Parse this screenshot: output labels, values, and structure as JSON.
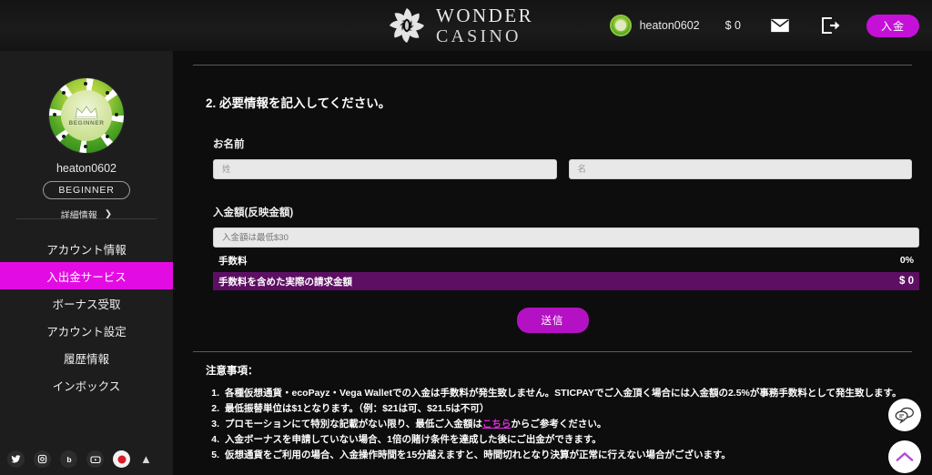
{
  "header": {
    "logo_line1": "WONDER",
    "logo_line2": "CASINO",
    "logo_icon": "spiral-emblem-icon",
    "username": "heaton0602",
    "balance": "$ 0",
    "mail_icon": "envelope-icon",
    "logout_icon": "logout-arrow-icon",
    "deposit_label": "入金"
  },
  "sidebar": {
    "avatar_icon": "poker-chip-avatar-icon",
    "avatar_chip_text": "BEGINNER",
    "username": "heaton0602",
    "rank_badge": "BEGINNER",
    "detail_link": "詳細情報",
    "detail_chevron": "chevron-right-icon",
    "nav": [
      {
        "label": "アカウント情報",
        "active": false
      },
      {
        "label": "入出金サービス",
        "active": true
      },
      {
        "label": "ボーナス受取",
        "active": false
      },
      {
        "label": "アカウント設定",
        "active": false
      },
      {
        "label": "履歴情報",
        "active": false
      },
      {
        "label": "インボックス",
        "active": false
      }
    ],
    "socials": [
      {
        "name": "twitter-icon",
        "glyph": "t"
      },
      {
        "name": "instagram-icon",
        "glyph": "i"
      },
      {
        "name": "blog-icon",
        "glyph": "b"
      },
      {
        "name": "youtube-icon",
        "glyph": "y"
      },
      {
        "name": "japan-flag-icon",
        "glyph": ""
      }
    ],
    "socials_chevron": "chevron-up-icon"
  },
  "main": {
    "step_title": "2. 必要情報を記入してください。",
    "name_label": "お名前",
    "last_name_placeholder": "姓",
    "first_name_placeholder": "名",
    "last_name_value": "",
    "first_name_value": "",
    "amount_label": "入金額(反映金額)",
    "amount_placeholder": "入金額は最低$30",
    "amount_value": "",
    "fee_label": "手数料",
    "fee_value": "0%",
    "total_label": "手数料を含めた実際の請求金額",
    "total_value": "$ 0",
    "submit_label": "送信",
    "notes_title": "注意事項：",
    "notes": [
      {
        "num": "1.",
        "text": "各種仮想通貨・ecoPayz・Vega Walletでの入金は手数料が発生致しません。STICPAYでご入金頂く場合には入金額の2.5%が事務手数料として発生致します。"
      },
      {
        "num": "2.",
        "text": "最低振替単位は$1となります。（例：$21は可、$21.5は不可）"
      },
      {
        "num": "3.",
        "text": "プロモーションにて特別な記載がない限り、最低ご入金額は",
        "link": "こちら",
        "text_after": "からご参考ください。"
      },
      {
        "num": "4.",
        "text": "入金ボーナスを申請していない場合、1倍の賭け条件を達成した後にご出金ができます。"
      },
      {
        "num": "5.",
        "text": "仮想通貨をご利用の場合、入金操作時間を15分越えますと、時間切れとなり決算が正常に行えない場合がございます。"
      }
    ]
  },
  "floating": {
    "chat_icon": "chat-bubbles-icon",
    "scroll_top_icon": "chevron-up-icon"
  },
  "colors": {
    "accent_magenta": "#e30be3",
    "deposit_button": "#c510d8",
    "total_row_purple": "#5d0f63",
    "link_pink": "#e32ae3"
  }
}
